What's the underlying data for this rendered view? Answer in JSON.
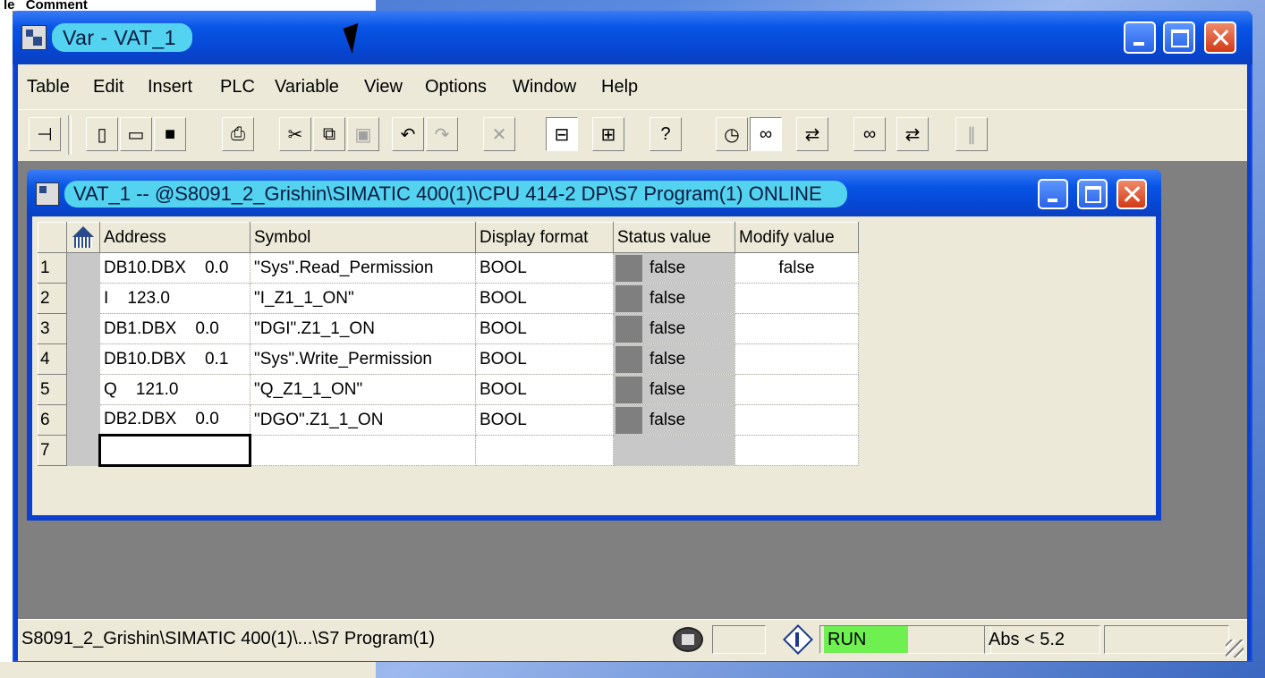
{
  "window": {
    "title": "Var - VAT_1",
    "menu": [
      "Table",
      "Edit",
      "Insert",
      "PLC",
      "Variable",
      "View",
      "Options",
      "Window",
      "Help"
    ]
  },
  "background": {
    "top_text": [
      "le",
      "Comment"
    ]
  },
  "child": {
    "title": "VAT_1 -- @S8091_2_Grishin\\SIMATIC 400(1)\\CPU 414-2 DP\\S7 Program(1)  ONLINE"
  },
  "table": {
    "headers": {
      "address": "Address",
      "symbol": "Symbol",
      "format": "Display format",
      "status": "Status value",
      "modify": "Modify value"
    },
    "rows": [
      {
        "num": "1",
        "address": "DB10.DBX    0.0",
        "symbol": "\"Sys\".Read_Permission",
        "format": "BOOL",
        "status": "false",
        "modify": "false"
      },
      {
        "num": "2",
        "address": "I    123.0",
        "symbol": "\"I_Z1_1_ON\"",
        "format": "BOOL",
        "status": "false",
        "modify": ""
      },
      {
        "num": "3",
        "address": "DB1.DBX    0.0",
        "symbol": "\"DGI\".Z1_1_ON",
        "format": "BOOL",
        "status": "false",
        "modify": ""
      },
      {
        "num": "4",
        "address": "DB10.DBX    0.1",
        "symbol": "\"Sys\".Write_Permission",
        "format": "BOOL",
        "status": "false",
        "modify": ""
      },
      {
        "num": "5",
        "address": "Q    121.0",
        "symbol": "\"Q_Z1_1_ON\"",
        "format": "BOOL",
        "status": "false",
        "modify": ""
      },
      {
        "num": "6",
        "address": "DB2.DBX    0.0",
        "symbol": "\"DGO\".Z1_1_ON",
        "format": "BOOL",
        "status": "false",
        "modify": ""
      },
      {
        "num": "7",
        "address": "",
        "symbol": "",
        "format": "",
        "status": "",
        "modify": ""
      }
    ]
  },
  "statusbar": {
    "path": "S8091_2_Grishin\\SIMATIC 400(1)\\...\\S7 Program(1)",
    "mode": "RUN",
    "version": "Abs < 5.2"
  },
  "colors": {
    "titlebar": "#0a3fcf",
    "title_pill": "#53d3f0",
    "run_indicator": "#6ef050",
    "status_cell": "#c8c8c8"
  }
}
